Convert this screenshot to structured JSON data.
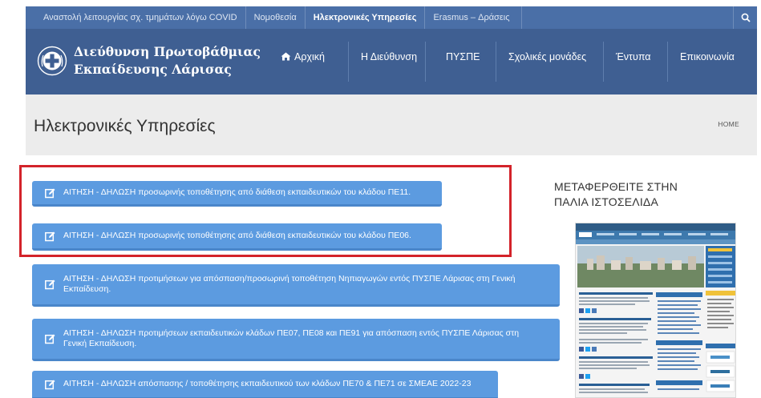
{
  "topbar": {
    "links": [
      {
        "label": "Αναστολή λειτουργίας σχ. τμημάτων λόγω COVID",
        "active": false
      },
      {
        "label": "Νομοθεσία",
        "active": false
      },
      {
        "label": "Ηλεκτρονικές Υπηρεσίες",
        "active": true
      },
      {
        "label": "Erasmus – Δράσεις",
        "active": false
      }
    ],
    "search_icon": "search-icon"
  },
  "header": {
    "brand_line1": "Διεύθυνση Πρωτοβάθμιας",
    "brand_line2": "Εκπαίδευσης Λάρισας",
    "logo_icon": "greek-cross-emblem-icon",
    "nav": [
      "Αρχική",
      "Η Διεύθυνση",
      "ΠΥΣΠΕ",
      "Σχολικές μονάδες",
      "Έντυπα",
      "Επικοινωνία"
    ]
  },
  "page": {
    "title": "Ηλεκτρονικές Υπηρεσίες",
    "breadcrumb": "HOME"
  },
  "services": [
    {
      "line1": "ΑΙΤΗΣΗ - ΔΗΛΩΣΗ προσωρινής τοποθέτησης από διάθεση εκπαιδευτικών του κλάδου ΠΕ11.",
      "line2": ""
    },
    {
      "line1": "ΑΙΤΗΣΗ - ΔΗΛΩΣΗ προσωρινής τοποθέτησης από διάθεση εκπαιδευτικών του κλάδου ΠΕ06.",
      "line2": ""
    },
    {
      "line1": "ΑΙΤΗΣΗ - ΔΗΛΩΣΗ προτιμήσεων για απόσπαση/προσωρινή τοποθέτηση Νηπιαγωγών εντός ΠΥΣΠΕ Λάρισας στη Γενική",
      "line2": "Εκπαίδευση."
    },
    {
      "line1": "ΑΙΤΗΣΗ - ΔΗΛΩΣΗ προτιμήσεων εκπαιδευτικών κλάδων ΠΕ07, ΠΕ08 και ΠΕ91 για απόσπαση εντός ΠΥΣΠΕ Λάρισας στη",
      "line2": "Γενική Εκπαίδευση."
    },
    {
      "line1": "ΑΙΤΗΣΗ - ΔΗΛΩΣΗ απόσπασης / τοποθέτησης εκπαιδευτικού των κλάδων ΠΕ70 & ΠΕ71 σε ΣΜΕΑΕ 2022-23",
      "line2": ""
    }
  ],
  "sidebar": {
    "title_line1": "ΜΕΤΑΦΕΡΘΕΙΤΕ ΣΤΗΝ",
    "title_line2": "ΠΑΛΙΑ ΙΣΤΟΣΕΛΙΔΑ"
  },
  "colors": {
    "topbar": "#4a6fa7",
    "header": "#3f5f92",
    "button": "#5c9be0",
    "highlight": "#d3232a"
  }
}
